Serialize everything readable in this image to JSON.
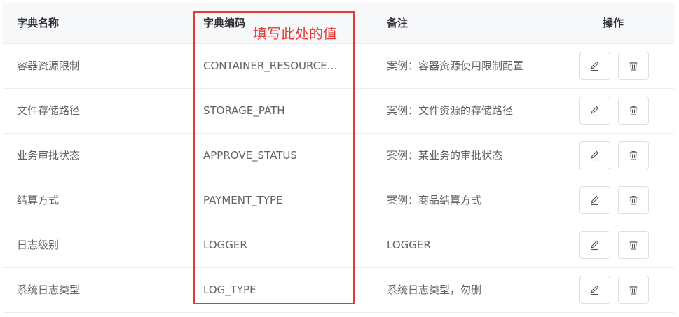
{
  "header": {
    "col_name": "字典名称",
    "col_code": "字典编码",
    "col_remark": "备注",
    "col_actions": "操作"
  },
  "annotation": {
    "hint": "填写此处的值",
    "color": "#e53935"
  },
  "rows": [
    {
      "name": "容器资源限制",
      "code": "CONTAINER_RESOURCE…",
      "remark": "案例：容器资源使用限制配置"
    },
    {
      "name": "文件存储路径",
      "code": "STORAGE_PATH",
      "remark": "案例：文件资源的存储路径"
    },
    {
      "name": "业务审批状态",
      "code": "APPROVE_STATUS",
      "remark": "案例：某业务的审批状态"
    },
    {
      "name": "结算方式",
      "code": "PAYMENT_TYPE",
      "remark": "案例：商品结算方式"
    },
    {
      "name": "日志级别",
      "code": "LOGGER",
      "remark": "LOGGER"
    },
    {
      "name": "系统日志类型",
      "code": "LOG_TYPE",
      "remark": "系统日志类型，勿删"
    }
  ],
  "icons": {
    "edit": "edit-icon",
    "delete": "trash-icon"
  }
}
